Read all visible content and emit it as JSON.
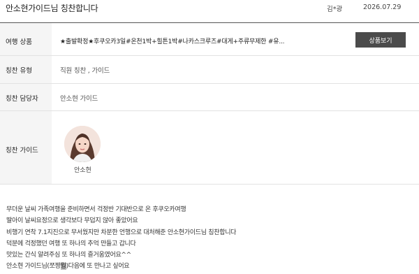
{
  "header": {
    "title": "안소현가이드님 칭찬합니다",
    "author": "김*광",
    "date": "2026.07.29"
  },
  "rows": {
    "product": {
      "label": "여행 상품",
      "value": "★출발확정★후쿠오카3일#온천1박+힐튼1박#나카스크루즈#대게+주류무제한 #유...",
      "button_label": "상품보기"
    },
    "type": {
      "label": "칭찬 유형",
      "value": "직원 칭찬 , 가이드"
    },
    "manager": {
      "label": "칭찬 담당자",
      "value": "안소현 가이드"
    },
    "guide": {
      "label": "칭찬 가이드",
      "name": "안소현"
    }
  },
  "review": {
    "lines": [
      "무더운 날씨 가족여행을 준비하면서 걱정반 기대반으로 온 후쿠오카여행",
      "딸아이 날씨요정으로 생각보다 무덥지 않아 좋았어요",
      "비행기 연착 7.1지진으로 무서웠지만 차분한 언행으로 대처해준 안소현가이드님 칭찬합니다",
      "덕분에 걱정했던 여행 또 하나의 추억 만들고 갑니다",
      "맛있는 간식 알려주심 또 하나의 즐거움였어요^^"
    ],
    "last_line_pre": "안소현 가이드님(쪼쨩",
    "last_line_highlight": "뭥",
    "last_line_post": ")다음에 또 만나고 싶어요"
  },
  "icons": {
    "guide_photo": "guide-avatar"
  },
  "colors": {
    "button_bg": "#4b4b4b",
    "label_bg": "#f5f5f5",
    "divider": "#555555"
  }
}
